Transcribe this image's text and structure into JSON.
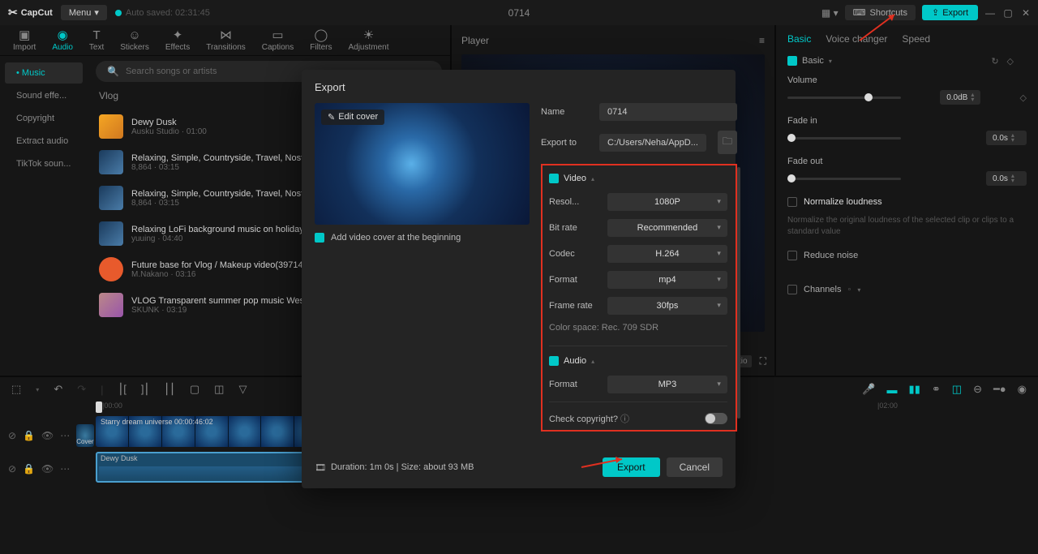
{
  "topbar": {
    "app": "CapCut",
    "menu": "Menu",
    "autosave": "Auto saved: 02:31:45",
    "project": "0714",
    "shortcuts": "Shortcuts",
    "export": "Export"
  },
  "tabs": {
    "import": "Import",
    "audio": "Audio",
    "text": "Text",
    "stickers": "Stickers",
    "effects": "Effects",
    "transitions": "Transitions",
    "captions": "Captions",
    "filters": "Filters",
    "adjustment": "Adjustment"
  },
  "sidebar": {
    "music": "Music",
    "sound": "Sound effe...",
    "copyright": "Copyright",
    "extract": "Extract audio",
    "tiktok": "TikTok soun..."
  },
  "search": {
    "placeholder": "Search songs or artists"
  },
  "content": {
    "header": "Vlog"
  },
  "tracks": [
    {
      "title": "Dewy Dusk",
      "meta": "Ausku Studio · 01:00"
    },
    {
      "title": "Relaxing, Simple, Countryside, Travel, Nost...",
      "meta": "8,864 · 03:15"
    },
    {
      "title": "Relaxing, Simple, Countryside, Travel, Nost...",
      "meta": "8,864 · 03:15"
    },
    {
      "title": "Relaxing LoFi background music on holiday...",
      "meta": "yuuing · 04:40"
    },
    {
      "title": "Future base for Vlog / Makeup video(39714...",
      "meta": "M.Nakano · 03:16"
    },
    {
      "title": "VLOG Transparent summer pop music West...",
      "meta": "SKUNK · 03:19"
    }
  ],
  "player": {
    "title": "Player"
  },
  "right": {
    "tabs": {
      "basic": "Basic",
      "voice": "Voice changer",
      "speed": "Speed"
    },
    "section": "Basic",
    "volume": "Volume",
    "volume_val": "0.0dB",
    "fadein": "Fade in",
    "fadein_val": "0.0s",
    "fadeout": "Fade out",
    "fadeout_val": "0.0s",
    "normalize": "Normalize loudness",
    "normalize_desc": "Normalize the original loudness of the selected clip or clips to a standard value",
    "reduce": "Reduce noise",
    "channels": "Channels"
  },
  "timeline": {
    "time1": "|00:00",
    "time2": "|02:00",
    "video_label": "Starry dream universe   00:00:46:02",
    "audio_label": "Dewy Dusk",
    "cover": "Cover"
  },
  "modal": {
    "title": "Export",
    "edit_cover": "Edit cover",
    "add_cover": "Add video cover at the beginning",
    "name_label": "Name",
    "name_value": "0714",
    "exportto_label": "Export to",
    "exportto_value": "C:/Users/Neha/AppD...",
    "video": "Video",
    "resolution_label": "Resol...",
    "resolution_value": "1080P",
    "bitrate_label": "Bit rate",
    "bitrate_value": "Recommended",
    "codec_label": "Codec",
    "codec_value": "H.264",
    "format_label": "Format",
    "format_value": "mp4",
    "framerate_label": "Frame rate",
    "framerate_value": "30fps",
    "colorspace": "Color space: Rec. 709 SDR",
    "audio": "Audio",
    "aformat_label": "Format",
    "aformat_value": "MP3",
    "copyright": "Check copyright?",
    "duration": "Duration: 1m 0s | Size: about 93 MB",
    "export_btn": "Export",
    "cancel_btn": "Cancel"
  }
}
